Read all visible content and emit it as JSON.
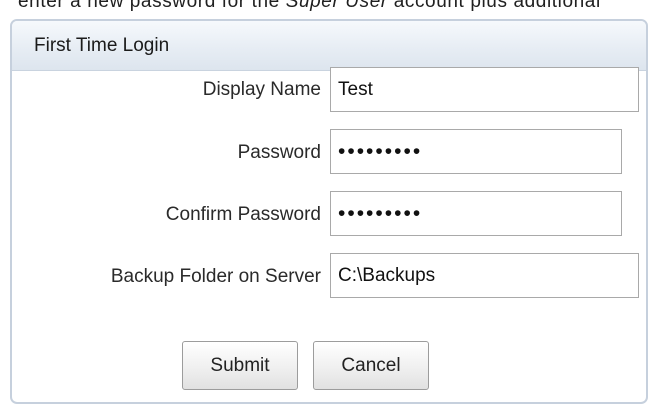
{
  "background_text": {
    "before": "enter a new password for the ",
    "emphasis": "Super User",
    "after": " account plus additional"
  },
  "dialog": {
    "title": "First Time Login"
  },
  "form": {
    "display_name": {
      "label": "Display Name",
      "value": "Test"
    },
    "password": {
      "label": "Password",
      "value": "123456789"
    },
    "confirm_password": {
      "label": "Confirm Password",
      "value": "123456789"
    },
    "backup_folder": {
      "label": "Backup Folder on Server",
      "value": "C:\\Backups"
    }
  },
  "buttons": {
    "submit": "Submit",
    "cancel": "Cancel"
  },
  "colors": {
    "header_gradient": "#e7edf4",
    "border": "#c6d0dd"
  }
}
